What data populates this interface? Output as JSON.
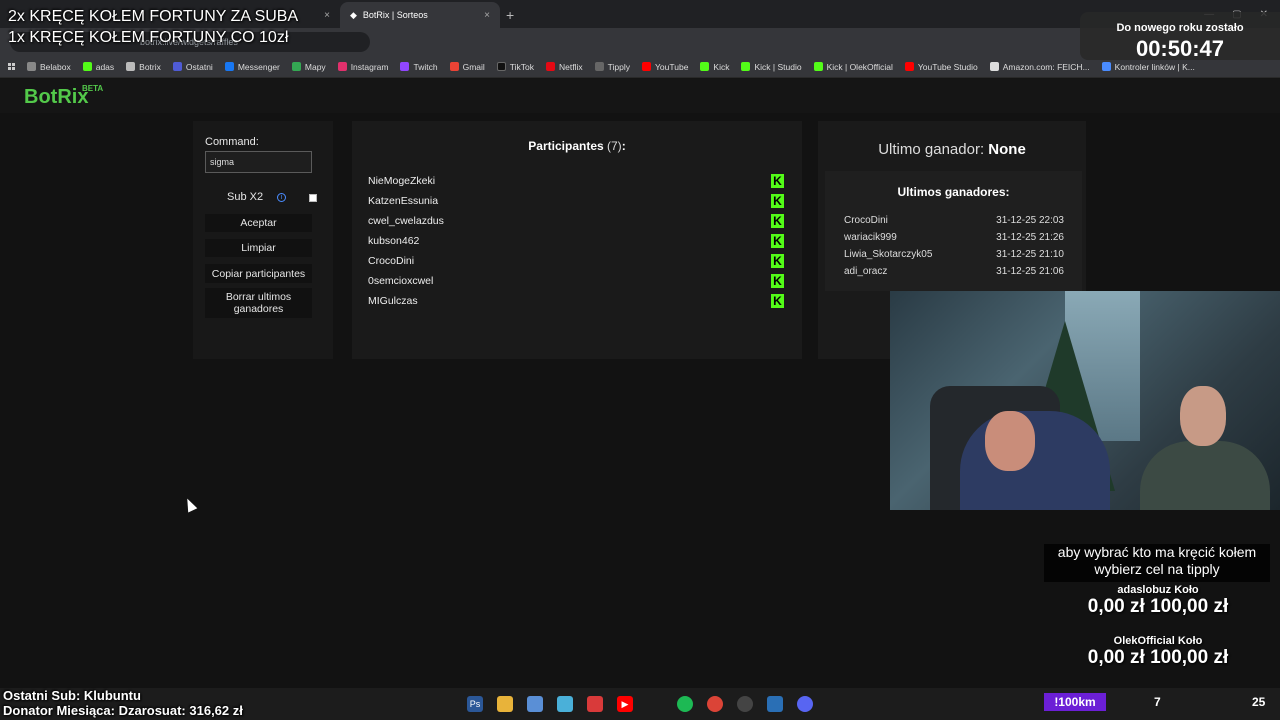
{
  "overlay": {
    "line1": "2x KRĘCĘ KOŁEM FORTUNY ZA SUBA",
    "line2": "1x KRĘCĘ KOŁEM FORTUNY CO 10zł",
    "countdown_label": "Do nowego roku zostało",
    "countdown_time": "00:50:47",
    "tippy_note": "aby wybrać kto ma kręcić kołem wybierz cel na tipply",
    "goals": [
      {
        "name": "adaslobuz Koło",
        "values": "0,00 zł  100,00 zł"
      },
      {
        "name": "OlekOfficial Koło",
        "values": "0,00 zł  100,00 zł"
      }
    ],
    "last_sub": "Ostatni Sub: Klubuntu",
    "donor": "Donator Miesiąca: Dzarosuat: 316,62 zł",
    "stat_tag": "!100km",
    "stat_a": "7",
    "stat_b": "25"
  },
  "browser": {
    "active_tab_title": "BotRix | Sorteos",
    "tab_close": "×",
    "tab_add": "+",
    "url": "botrix.live/widgets/raffles",
    "bookmarks": [
      "Belabox",
      "adas",
      "Botrix",
      "Ostatni",
      "Messenger",
      "Mapy",
      "Instagram",
      "Twitch",
      "Gmail",
      "TikTok",
      "Netflix",
      "Tipply",
      "YouTube",
      "Kick",
      "Kick | Studio",
      "Kick | OlekOfficial",
      "YouTube Studio",
      "Amazon.com: FEICH...",
      "Kontroler linków | K..."
    ]
  },
  "site": {
    "logo": "BotRix",
    "logo_badge": "BETA"
  },
  "controls": {
    "command_label": "Command:",
    "command_value": "sigma",
    "sub_label": "Sub X2",
    "accept": "Aceptar",
    "clear": "Limpiar",
    "copy": "Copiar participantes",
    "delete_winners": "Borrar ultimos ganadores"
  },
  "participants": {
    "title": "Participantes",
    "count": "(7)",
    "names": [
      "NieMogeZkeki",
      "KatzenEssunia",
      "cwel_cwelazdus",
      "kubson462",
      "CrocoDini",
      "0semcioxcwel",
      "MIGulczas"
    ]
  },
  "winners": {
    "last_label": "Ultimo ganador:",
    "last_value": "None",
    "list_title": "Ultimos ganadores:",
    "rows": [
      {
        "name": "CrocoDini",
        "time": "31-12-25 22:03"
      },
      {
        "name": "wariacik999",
        "time": "31-12-25 21:26"
      },
      {
        "name": "Liwia_Skotarczyk05",
        "time": "31-12-25 21:10"
      },
      {
        "name": "adi_oracz",
        "time": "31-12-25 21:06"
      }
    ]
  }
}
